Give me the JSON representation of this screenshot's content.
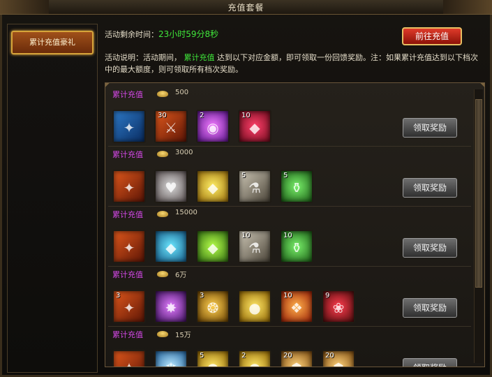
{
  "window": {
    "title": "充值套餐"
  },
  "sidebar": {
    "active_item": "累计充值豪礼"
  },
  "header": {
    "countdown_label": "活动剩余时间：",
    "countdown_value": "23小时59分8秒",
    "go_recharge": "前往充值"
  },
  "description": {
    "prefix": "活动说明：活动期间，",
    "highlight": "累计充值",
    "suffix": "达到以下对应金额，即可领取一份回馈奖励。注：如果累计充值达到以下档次中的最大额度，则可领取所有档次奖励。"
  },
  "tiers": [
    {
      "title": "累计充值",
      "amount": "500",
      "claim": "领取奖励",
      "items": [
        {
          "icon": "blue-book-icon",
          "count": ""
        },
        {
          "icon": "twin-swords-icon",
          "count": "30"
        },
        {
          "icon": "purple-orb-icon",
          "count": "2"
        },
        {
          "icon": "ruby-gem-icon",
          "count": "10"
        }
      ]
    },
    {
      "title": "累计充值",
      "amount": "3000",
      "claim": "领取奖励",
      "items": [
        {
          "icon": "red-book-icon",
          "count": ""
        },
        {
          "icon": "stone-heart-icon",
          "count": ""
        },
        {
          "icon": "gold-gem-icon",
          "count": ""
        },
        {
          "icon": "potion-bottle-icon",
          "count": "5"
        },
        {
          "icon": "green-potion-icon",
          "count": "5"
        }
      ]
    },
    {
      "title": "累计充值",
      "amount": "15000",
      "claim": "领取奖励",
      "items": [
        {
          "icon": "red-book-icon",
          "count": ""
        },
        {
          "icon": "cyan-gem-icon",
          "count": ""
        },
        {
          "icon": "green-gem-icon",
          "count": ""
        },
        {
          "icon": "potion-bottle-icon",
          "count": "10"
        },
        {
          "icon": "green-potion-icon",
          "count": "10"
        }
      ]
    },
    {
      "title": "累计充值",
      "amount": "6万",
      "claim": "领取奖励",
      "items": [
        {
          "icon": "red-book-icon",
          "count": "3"
        },
        {
          "icon": "violet-orb-icon",
          "count": ""
        },
        {
          "icon": "golden-worm-icon",
          "count": "3"
        },
        {
          "icon": "gold-coin-icon",
          "count": ""
        },
        {
          "icon": "flame-rune-icon",
          "count": "10"
        },
        {
          "icon": "red-rose-icon",
          "count": "9"
        }
      ]
    },
    {
      "title": "累计充值",
      "amount": "15万",
      "claim": "领取奖励",
      "items": [
        {
          "icon": "red-book-icon",
          "count": ""
        },
        {
          "icon": "ice-crystal-icon",
          "count": ""
        },
        {
          "icon": "gold-coin-icon",
          "count": "5"
        },
        {
          "icon": "gold-coin-icon",
          "count": "2"
        },
        {
          "icon": "lion-head-icon",
          "count": "20"
        },
        {
          "icon": "lion-head-icon",
          "count": "20"
        }
      ]
    }
  ]
}
